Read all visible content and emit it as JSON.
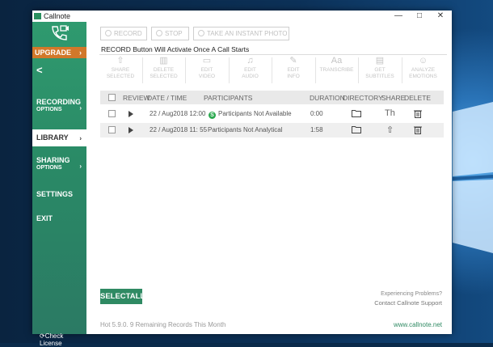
{
  "window": {
    "title": "Callnote",
    "controls": [
      "—",
      "□",
      "✕"
    ]
  },
  "sidebar": {
    "upgrade_label": "UPGRADE",
    "upgrade_arrow": "›",
    "back_glyph": "<",
    "items": [
      {
        "label": "RECORDING",
        "sub": "OPTIONS",
        "chevron": "›"
      },
      {
        "label": "LIBRARY",
        "sub": "",
        "chevron": "›"
      },
      {
        "label": "SHARING",
        "sub": "OPTIONS",
        "chevron": "›"
      },
      {
        "label": "SETTINGS",
        "sub": "",
        "chevron": ""
      },
      {
        "label": "EXIT",
        "sub": "",
        "chevron": ""
      }
    ],
    "check_license": "Check License"
  },
  "record_buttons": {
    "record": "RECORD",
    "stop": "STOP",
    "snapshot": "TAKE AN INSTANT PHOTO"
  },
  "notice": "RECORD Button Will Activate Once A Call Starts",
  "toolbar": [
    {
      "label": "SHARE\nSELECTED",
      "icon": "share-icon",
      "glyph": "⇧"
    },
    {
      "label": "DELETE\nSELECTED",
      "icon": "trash-icon",
      "glyph": "▥"
    },
    {
      "label": "EDIT\nVIDEO",
      "icon": "video-icon",
      "glyph": "▭"
    },
    {
      "label": "EDIT\nAUDIO",
      "icon": "audio-icon",
      "glyph": "♫"
    },
    {
      "label": "EDIT\nINFO",
      "icon": "pencil-icon",
      "glyph": "✎"
    },
    {
      "label": "TRANSCRIBE",
      "icon": "transcribe-icon",
      "glyph": "Aa"
    },
    {
      "label": "GET\nSUBTITLES",
      "icon": "subtitles-icon",
      "glyph": "▤"
    },
    {
      "label": "ANALYZE\nEMOTIONS",
      "icon": "emotions-icon",
      "glyph": "☺"
    }
  ],
  "table": {
    "headers": {
      "review": "REVIEW",
      "datetime": "DATE / TIME",
      "participants": "PARTICIPANTS",
      "duration": "DURATION",
      "directory": "DIRECTORY",
      "share": "SHARE",
      "delete": "DELETE"
    },
    "rows": [
      {
        "datetime": "22 / Aug2018 12:00",
        "participants": "Participants Not Available",
        "duration": "0:00",
        "has_skype": true,
        "share_glyph": "Th"
      },
      {
        "datetime": "22 / Aug2018 11: 55",
        "participants": "Participants Not Analytical",
        "duration": "1:58",
        "has_skype": false,
        "share_glyph": "⇧"
      }
    ]
  },
  "bottom": {
    "select_all": "SELECTALL",
    "experiencing": "Experiencing Problems?",
    "contact": "Contact Callnote Support",
    "version": "Hot 5.9.0. 9 Remaining Records This Month",
    "website": "www.callnote.net"
  },
  "colors": {
    "sidebar_green": "#2f9a6f",
    "upgrade_orange": "#d1782a",
    "accent_green": "#2f8a63"
  }
}
